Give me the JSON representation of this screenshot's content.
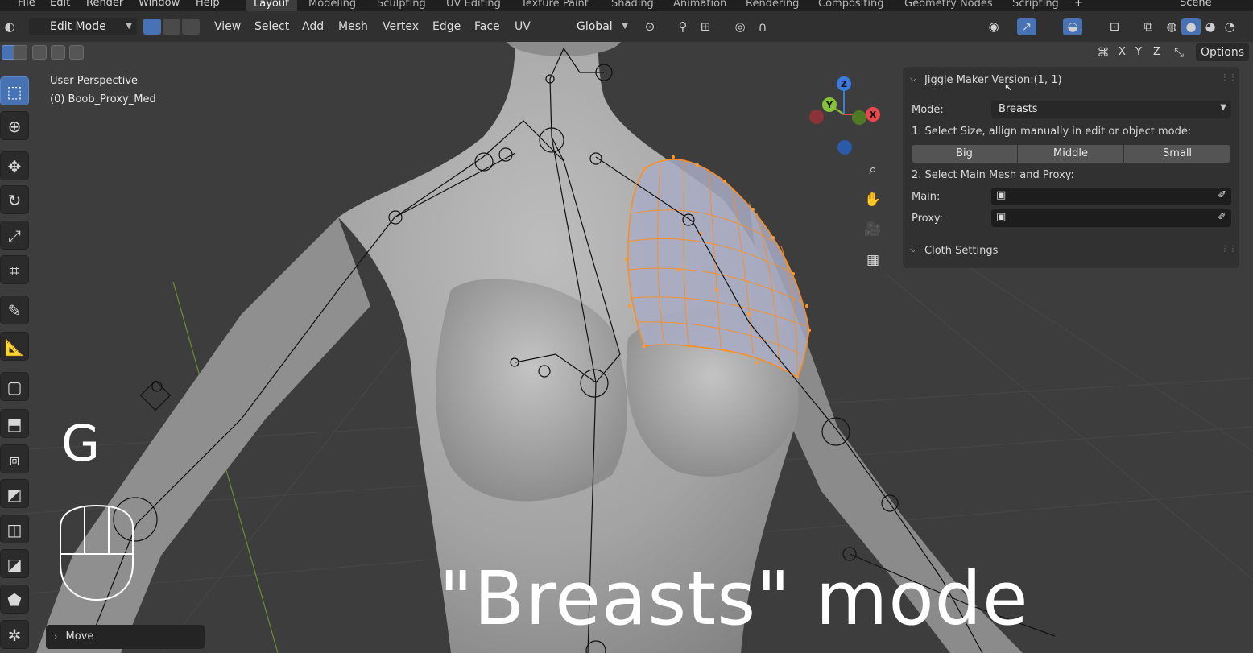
{
  "menubar": {
    "menus": [
      "File",
      "Edit",
      "Render",
      "Window",
      "Help"
    ],
    "workspaces": [
      "Layout",
      "Modeling",
      "Sculpting",
      "UV Editing",
      "Texture Paint",
      "Shading",
      "Animation",
      "Rendering",
      "Compositing",
      "Geometry Nodes",
      "Scripting"
    ],
    "active_workspace": "Layout",
    "add_tab": "+",
    "scene": "Scene"
  },
  "header": {
    "mode": "Edit Mode",
    "menus": [
      "View",
      "Select",
      "Add",
      "Mesh",
      "Vertex",
      "Edge",
      "Face",
      "UV"
    ],
    "transform_orientation": "Global",
    "options": "Options",
    "axes": [
      "X",
      "Y",
      "Z"
    ]
  },
  "viewport": {
    "perspective": "User Perspective",
    "object": "(0) Boob_Proxy_Med",
    "key_hint": "G",
    "caption": "\"Breasts\" mode"
  },
  "gizmo": {
    "x": "X",
    "y": "Y",
    "z": "Z",
    "colors": {
      "x": "#e8474c",
      "y": "#85c23a",
      "z": "#3c7bde"
    }
  },
  "npanel": {
    "title": "Jiggle Maker Version:(1, 1)",
    "mode_label": "Mode:",
    "mode_value": "Breasts",
    "step1": "1. Select Size, allign manually in edit or object mode:",
    "sizes": [
      "Big",
      "Middle",
      "Small"
    ],
    "step2": "2. Select Main Mesh and Proxy:",
    "main_label": "Main:",
    "proxy_label": "Proxy:",
    "cloth_settings": "Cloth Settings"
  },
  "operator_panel": {
    "label": "Move"
  },
  "colors": {
    "accent": "#4772b3",
    "selection": "#ff8c1a"
  }
}
